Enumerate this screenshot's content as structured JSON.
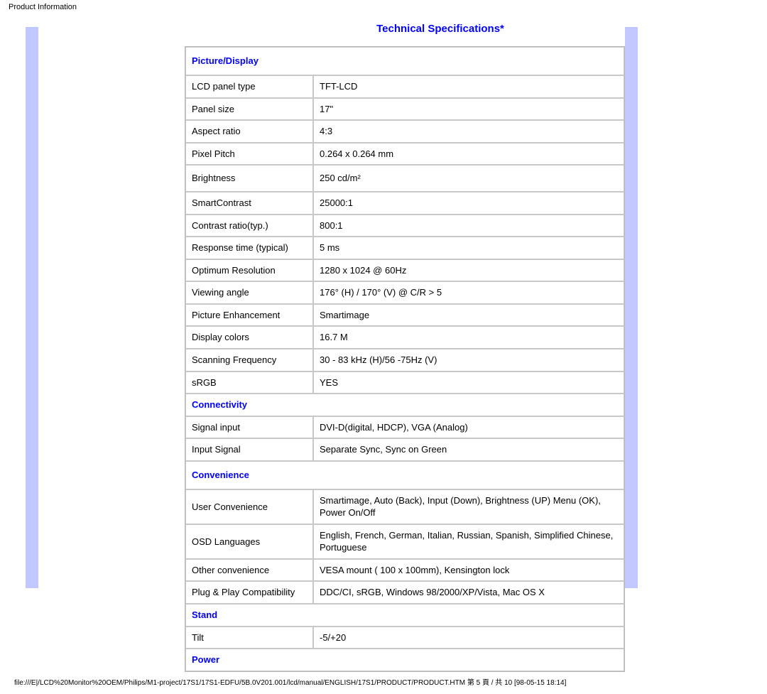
{
  "header": {
    "page_title": "Product Information"
  },
  "title": "Technical Specifications*",
  "sections": {
    "picture_display": {
      "heading": "Picture/Display",
      "rows": [
        {
          "k": "LCD panel type",
          "v": "TFT-LCD"
        },
        {
          "k": "Panel size",
          "v": "17\""
        },
        {
          "k": "Aspect ratio",
          "v": "4:3"
        },
        {
          "k": "Pixel Pitch",
          "v": "0.264 x 0.264 mm"
        },
        {
          "k": "Brightness",
          "v": "250 cd/m²"
        },
        {
          "k": "SmartContrast",
          "v": "25000:1"
        },
        {
          "k": "Contrast ratio(typ.)",
          "v": "800:1"
        },
        {
          "k": "Response time (typical)",
          "v": "5 ms"
        },
        {
          "k": "Optimum Resolution",
          "v": "1280 x 1024 @ 60Hz"
        },
        {
          "k": "Viewing angle",
          "v": "176° (H) / 170° (V) @ C/R > 5"
        },
        {
          "k": "Picture Enhancement",
          "v": "Smartimage"
        },
        {
          "k": "Display colors",
          "v": "16.7 M"
        },
        {
          "k": "Scanning Frequency",
          "v": "30 - 83 kHz (H)/56 -75Hz (V)"
        },
        {
          "k": "sRGB",
          "v": "YES"
        }
      ]
    },
    "connectivity": {
      "heading": "Connectivity",
      "rows": [
        {
          "k": "Signal input",
          "v": "DVI-D(digital, HDCP), VGA (Analog)"
        },
        {
          "k": "Input Signal",
          "v": "Separate Sync, Sync on Green"
        }
      ]
    },
    "convenience": {
      "heading": "Convenience",
      "rows": [
        {
          "k": "User Convenience",
          "v": "Smartimage, Auto (Back), Input (Down), Brightness (UP) Menu (OK), Power On/Off"
        },
        {
          "k": "OSD Languages",
          "v": "English, French, German, Italian, Russian, Spanish, Simplified Chinese, Portuguese"
        },
        {
          "k": "Other convenience",
          "v": "VESA mount ( 100 x 100mm), Kensington lock"
        },
        {
          "k": "Plug & Play Compatibility",
          "v": "DDC/CI, sRGB, Windows 98/2000/XP/Vista, Mac OS X"
        }
      ]
    },
    "stand": {
      "heading": "Stand",
      "rows": [
        {
          "k": "Tilt",
          "v": "-5/+20"
        }
      ]
    },
    "power": {
      "heading": "Power"
    }
  },
  "footer": {
    "path": "file:///E|/LCD%20Monitor%20OEM/Philips/M1-project/17S1/17S1-EDFU/5B.0V201.001/lcd/manual/ENGLISH/17S1/PRODUCT/PRODUCT.HTM 第 5 頁 / 共 10 [98-05-15 18:14]"
  }
}
